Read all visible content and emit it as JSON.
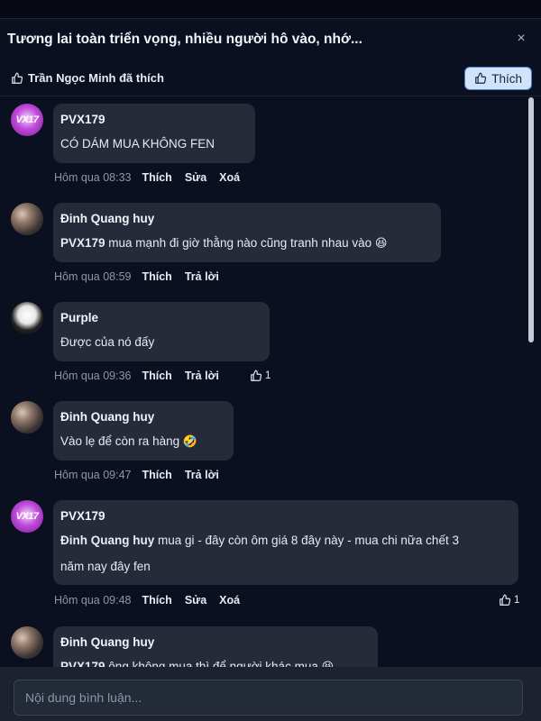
{
  "header": {
    "title": "Tương lai toàn triển vọng, nhiều người hô vào, nhớ...",
    "close_glyph": "×"
  },
  "likebar": {
    "liked_by_text": "Trần Ngọc Minh đã thích",
    "like_button_label": "Thích"
  },
  "comments": [
    {
      "author": "PVX179",
      "avatar_text": "VX17",
      "text": "CÓ DÁM MUA KHÔNG FEN",
      "time": "Hôm qua 08:33",
      "actions": [
        "Thích",
        "Sửa",
        "Xoá"
      ]
    },
    {
      "author": "Đinh Quang huy",
      "mention": "PVX179",
      "text": " mua mạnh đi giờ thằng nào cũng tranh nhau vào",
      "emoji": "😆",
      "time": "Hôm qua 08:59",
      "actions": [
        "Thích",
        "Trả lời"
      ]
    },
    {
      "author": "Purple",
      "text": "Được của nó đấy",
      "time": "Hôm qua 09:36",
      "actions": [
        "Thích",
        "Trả lời"
      ],
      "like_count": "1"
    },
    {
      "author": "Đinh Quang huy",
      "text": "Vào lẹ để còn ra hàng",
      "emoji": "🤣",
      "time": "Hôm qua 09:47",
      "actions": [
        "Thích",
        "Trả lời"
      ]
    },
    {
      "author": "PVX179",
      "avatar_text": "VX17",
      "mention": "Đinh Quang huy",
      "text": " mua gi - đây còn ôm giá 8 đây này - mua chi nữa chết 3",
      "text_line2": "năm nay đây fen",
      "time": "Hôm qua 09:48",
      "actions": [
        "Thích",
        "Sửa",
        "Xoá"
      ],
      "like_count": "1"
    },
    {
      "author": "Đinh Quang huy",
      "mention": "PVX179",
      "text": " ông không mua thì để người khác mua",
      "emoji": "😆"
    }
  ],
  "composer": {
    "placeholder": "Nội dung bình luận..."
  },
  "colors": {
    "background": "#0b1020",
    "bubble": "#252b38",
    "like_button_bg": "#cfe3fb"
  },
  "icons": [
    "thumbs-up-icon",
    "close-icon"
  ]
}
